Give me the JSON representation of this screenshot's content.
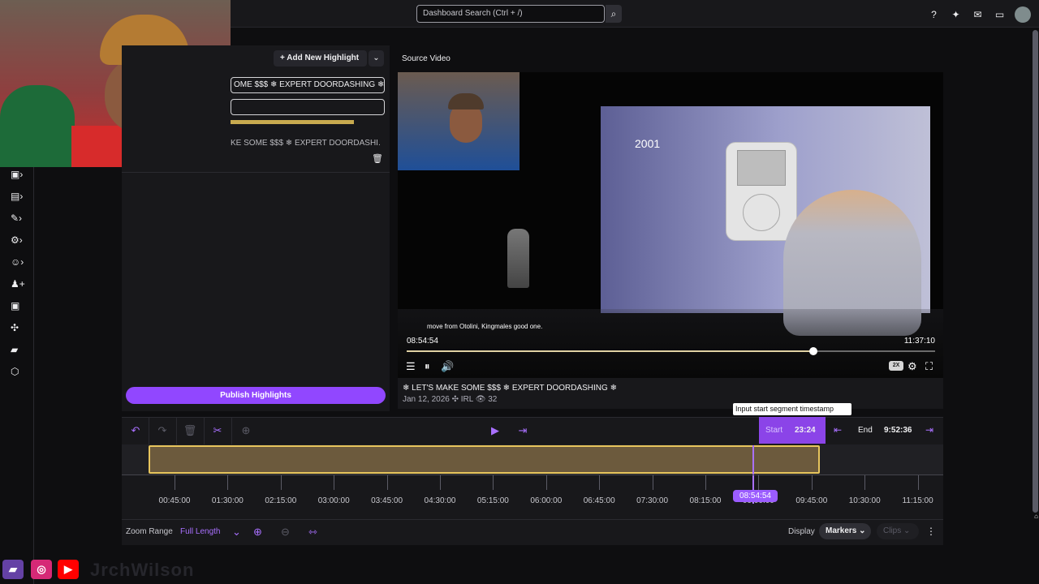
{
  "topbar": {
    "search_placeholder": "Dashboard Search (Ctrl + /)",
    "search_icon": "⌕",
    "icons": [
      "help-icon",
      "sparkle-icon",
      "inbox-icon",
      "chat-icon",
      "avatar"
    ]
  },
  "highlight": {
    "add_button": "+  Add New Highlight",
    "dropdown": "⌄",
    "field_title": "OME $$$ ❄ EXPERT DOORDASHING ❄",
    "field_second": "",
    "item_title": "KE SOME $$$ ❄ EXPERT DOORDASHI...",
    "trash": "🗑",
    "publish": "Publish Highlights"
  },
  "video": {
    "source_label": "Source Video",
    "year": "2001",
    "caption": "move from Otolini, Kingmales good one.",
    "current_time": "08:54:54",
    "total_time": "11:37:10",
    "progress_fraction": 0.77,
    "speed": "2X",
    "title": "❄ LET'S MAKE SOME $$$ ❄ EXPERT DOORDASHING ❄",
    "meta": "Jan 12, 2026  ✣ IRL  👁 32"
  },
  "segment": {
    "tooltip": "Input start segment timestamp",
    "start_label": "Start",
    "start_time": "23:24",
    "end_label": "End",
    "end_time": "9:52:36"
  },
  "timeline": {
    "ticks": [
      "00:45:00",
      "01:30:00",
      "02:15:00",
      "03:00:00",
      "03:45:00",
      "04:30:00",
      "05:15:00",
      "06:00:00",
      "06:45:00",
      "07:30:00",
      "08:15:00",
      "09:00:00",
      "09:45:00",
      "10:30:00",
      "11:15:00"
    ],
    "playhead_time": "08:54:54"
  },
  "footer": {
    "zoom_label": "Zoom Range",
    "zoom_value": "Full Length",
    "display_label": "Display",
    "markers": "Markers",
    "clips": "Clips"
  },
  "social": {
    "handle": "JrchWilson"
  },
  "colors": {
    "accent": "#9147ff",
    "highlight": "#e7c55d",
    "background": "#0e0e10"
  }
}
